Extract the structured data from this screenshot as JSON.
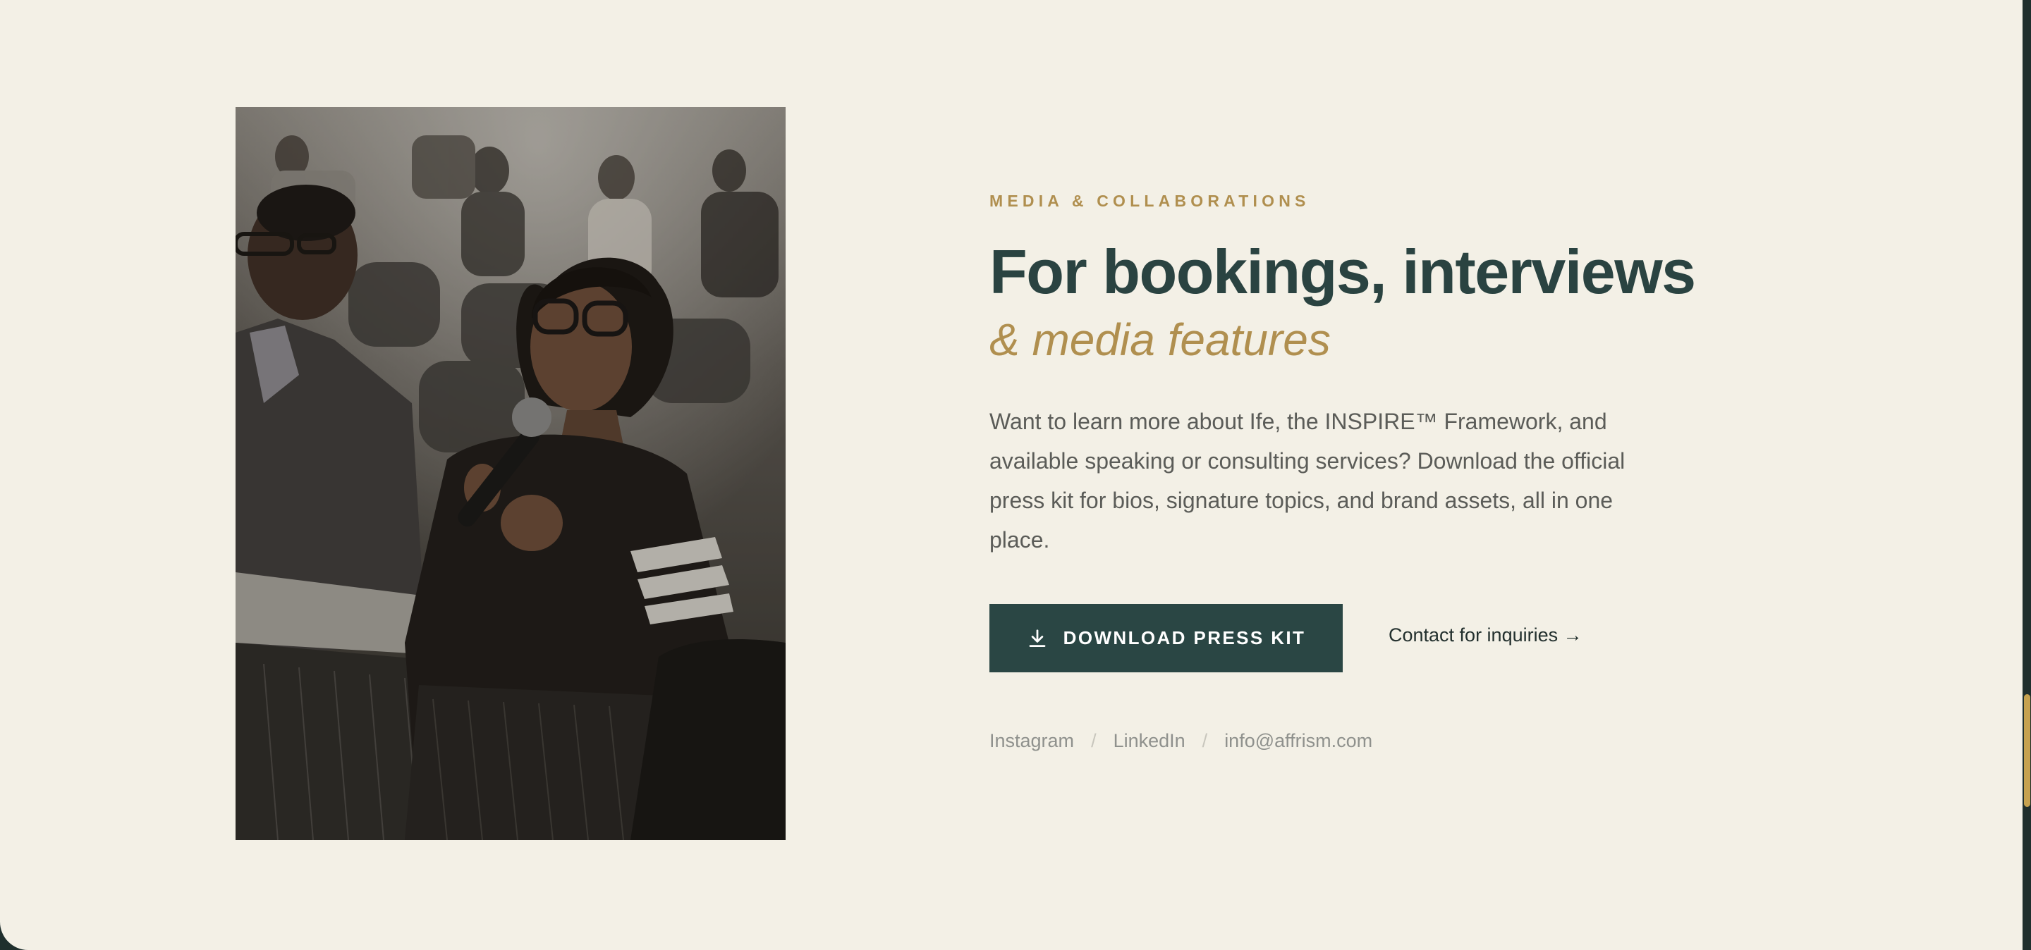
{
  "section": {
    "eyebrow": "MEDIA & COLLABORATIONS",
    "heading": "For bookings, interviews",
    "subheading": "& media features",
    "body": "Want to learn more about Ife, the INSPIRE™ Framework, and available speaking or consulting services? Download the official press kit for bios, signature topics, and brand assets, all in one place."
  },
  "actions": {
    "download_label": "DOWNLOAD PRESS KIT",
    "download_icon": "download-icon",
    "contact_label": "Contact for inquiries →"
  },
  "socials": {
    "instagram": "Instagram",
    "separator": "/",
    "linkedin": "LinkedIn",
    "email": "info@affrism.com"
  },
  "colors": {
    "background": "#f3f0e6",
    "accent_gold": "#b08f4f",
    "heading_green": "#2a4341",
    "button_green": "#2a4644",
    "scroll_thumb": "#c6a24f"
  }
}
